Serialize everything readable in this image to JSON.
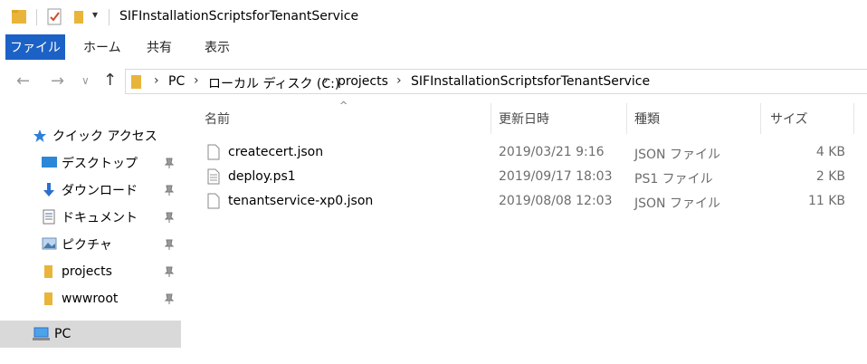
{
  "window": {
    "title": "SIFInstallationScriptsforTenantService"
  },
  "ribbon": {
    "tabs": [
      "ファイル",
      "ホーム",
      "共有",
      "表示"
    ]
  },
  "address": {
    "crumbs": [
      "PC",
      "ローカル ディスク (C:)",
      "projects",
      "SIFInstallationScriptsforTenantService"
    ]
  },
  "sidebar": {
    "items": [
      {
        "label": "クイック アクセス",
        "icon": "star-icon",
        "pinned": false
      },
      {
        "label": "デスクトップ",
        "icon": "desktop-icon",
        "pinned": true
      },
      {
        "label": "ダウンロード",
        "icon": "download-icon",
        "pinned": true
      },
      {
        "label": "ドキュメント",
        "icon": "documents-icon",
        "pinned": true
      },
      {
        "label": "ピクチャ",
        "icon": "pictures-icon",
        "pinned": true
      },
      {
        "label": "projects",
        "icon": "folder-icon",
        "pinned": true
      },
      {
        "label": "wwwroot",
        "icon": "folder-icon",
        "pinned": true
      },
      {
        "label": "PC",
        "icon": "pc-icon",
        "pinned": false,
        "selected": true
      }
    ]
  },
  "columns": {
    "name": "名前",
    "date": "更新日時",
    "type": "種類",
    "size": "サイズ"
  },
  "files": [
    {
      "name": "createcert.json",
      "date": "2019/03/21 9:16",
      "type": "JSON ファイル",
      "size": "4 KB",
      "icon": "json-file-icon"
    },
    {
      "name": "deploy.ps1",
      "date": "2019/09/17 18:03",
      "type": "PS1 ファイル",
      "size": "2 KB",
      "icon": "script-file-icon"
    },
    {
      "name": "tenantservice-xp0.json",
      "date": "2019/08/08 12:03",
      "type": "JSON ファイル",
      "size": "11 KB",
      "icon": "json-file-icon"
    }
  ],
  "colors": {
    "accent": "#1c62c6",
    "folder": "#e8b53a",
    "selected_row": "#d9d9d9"
  }
}
